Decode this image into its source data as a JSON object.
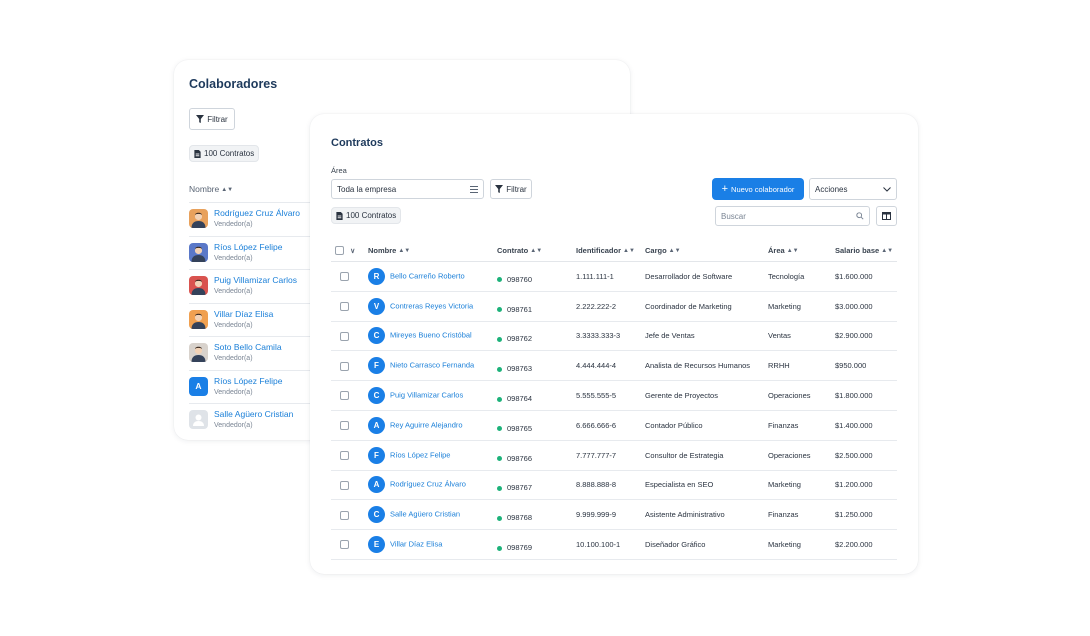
{
  "colaboradores": {
    "title": "Colaboradores",
    "filter_label": "Filtrar",
    "count_label": "100 Contratos",
    "column_name": "Nombre",
    "people": [
      {
        "name": "Rodríguez Cruz Álvaro",
        "role": "Vendedor(a)",
        "avatar": "photo",
        "color": "#e8a15c"
      },
      {
        "name": "Ríos López Felipe",
        "role": "Vendedor(a)",
        "avatar": "photo",
        "color": "#5a78c8"
      },
      {
        "name": "Puig Villamizar Carlos",
        "role": "Vendedor(a)",
        "avatar": "photo",
        "color": "#d9534f"
      },
      {
        "name": "Villar Díaz Elisa",
        "role": "Vendedor(a)",
        "avatar": "photo",
        "color": "#f0a050"
      },
      {
        "name": "Soto Bello Camila",
        "role": "Vendedor(a)",
        "avatar": "photo",
        "color": "#d8d2cc"
      },
      {
        "name": "Ríos López Felipe",
        "role": "Vendedor(a)",
        "avatar": "A",
        "color": "#1a7fe6"
      },
      {
        "name": "Salle Agüero Cristian",
        "role": "Vendedor(a)",
        "avatar": "user-placeholder-icon",
        "color": "#dfe3e8"
      }
    ]
  },
  "contratos": {
    "title": "Contratos",
    "area_label": "Área",
    "area_value": "Toda la empresa",
    "filter_label": "Filtrar",
    "count_label": "100 Contratos",
    "new_button": "Nuevo colaborador",
    "actions_label": "Acciones",
    "search_placeholder": "Buscar",
    "columns": [
      "Nombre",
      "Contrato",
      "Identificador",
      "Cargo",
      "Área",
      "Salario base"
    ],
    "rows": [
      {
        "initial": "R",
        "name": "Bello Carreño Roberto",
        "contract": "098760",
        "id": "1.111.111-1",
        "cargo": "Desarrollador de Software",
        "area": "Tecnología",
        "salary": "$1.600.000"
      },
      {
        "initial": "V",
        "name": "Contreras Reyes Victoria",
        "contract": "098761",
        "id": "2.222.222-2",
        "cargo": "Coordinador de Marketing",
        "area": "Marketing",
        "salary": "$3.000.000"
      },
      {
        "initial": "C",
        "name": "Mireyes Bueno Cristóbal",
        "contract": "098762",
        "id": "3.3333.333-3",
        "cargo": "Jefe de Ventas",
        "area": "Ventas",
        "salary": "$2.900.000"
      },
      {
        "initial": "F",
        "name": "Nieto Carrasco Fernanda",
        "contract": "098763",
        "id": "4.444.444-4",
        "cargo": "Analista de Recursos Humanos",
        "area": "RRHH",
        "salary": "$950.000"
      },
      {
        "initial": "C",
        "name": "Puig Villamizar Carlos",
        "contract": "098764",
        "id": "5.555.555-5",
        "cargo": "Gerente de Proyectos",
        "area": "Operaciones",
        "salary": "$1.800.000"
      },
      {
        "initial": "A",
        "name": "Rey Aguirre Alejandro",
        "contract": "098765",
        "id": "6.666.666-6",
        "cargo": "Contador Público",
        "area": "Finanzas",
        "salary": "$1.400.000"
      },
      {
        "initial": "F",
        "name": "Ríos López Felipe",
        "contract": "098766",
        "id": "7.777.777-7",
        "cargo": "Consultor de Estrategia",
        "area": "Operaciones",
        "salary": "$2.500.000"
      },
      {
        "initial": "A",
        "name": "Rodríguez Cruz Álvaro",
        "contract": "098767",
        "id": "8.888.888-8",
        "cargo": "Especialista en SEO",
        "area": "Marketing",
        "salary": "$1.200.000"
      },
      {
        "initial": "C",
        "name": "Salle Agüero Cristian",
        "contract": "098768",
        "id": "9.999.999-9",
        "cargo": "Asistente Administrativo",
        "area": "Finanzas",
        "salary": "$1.250.000"
      },
      {
        "initial": "E",
        "name": "Villar Díaz Elisa",
        "contract": "098769",
        "id": "10.100.100-1",
        "cargo": "Diseñador Gráfico",
        "area": "Marketing",
        "salary": "$2.200.000"
      }
    ]
  },
  "colors": {
    "accent": "#1a7fe6",
    "status_active": "#1db27a",
    "title": "#1e3a5c"
  }
}
